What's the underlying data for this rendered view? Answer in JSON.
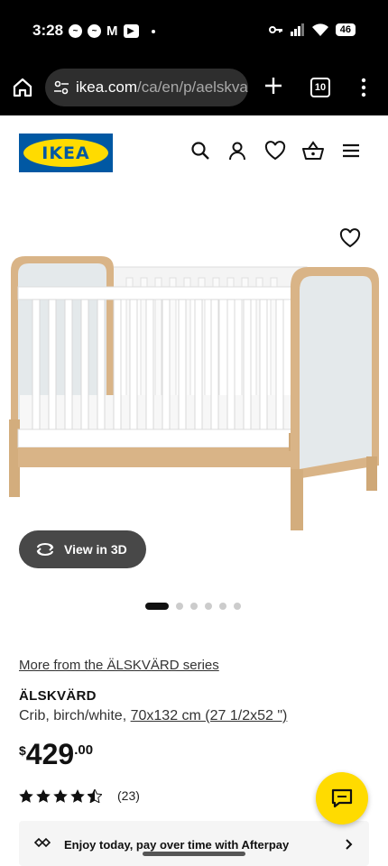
{
  "status_bar": {
    "time": "3:28",
    "battery": "46"
  },
  "browser": {
    "url_host": "ikea.com",
    "url_path": "/ca/en/p/aelskva",
    "tab_count": "10"
  },
  "brand": {
    "logo_text": "IKEA",
    "blue": "#0058a3",
    "yellow": "#ffdb00"
  },
  "header_icons": [
    "search-icon",
    "account-icon",
    "heart-icon",
    "basket-icon",
    "hamburger-menu-icon"
  ],
  "product_media": {
    "view3d_label": "View in 3D",
    "image_count": 6,
    "active_image": 1
  },
  "product": {
    "series_link": "More from the ÄLSKVÄRD series",
    "name": "ÄLSKVÄRD",
    "description_prefix": "Crib, birch/white, ",
    "size": "70x132 cm (27 1/2x52 \")",
    "price_currency": "$",
    "price_integer": "429",
    "price_decimal": ".00",
    "rating_stars": 4.5,
    "rating_count": "(23)"
  },
  "afterpay": {
    "text": "Enjoy today, pay over time with Afterpay"
  }
}
